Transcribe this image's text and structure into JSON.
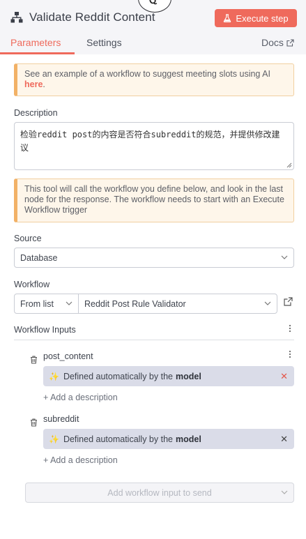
{
  "header": {
    "title": "Validate Reddit Content",
    "execute_label": "Execute step",
    "badge_text": "Q"
  },
  "tabs": {
    "parameters": "Parameters",
    "settings": "Settings",
    "docs": "Docs"
  },
  "notice_example": {
    "text": "See an example of a workflow to suggest meeting slots using AI ",
    "link": "here",
    "suffix": "."
  },
  "description": {
    "label": "Description",
    "value": "检验reddit post的内容是否符合subreddit的规范，并提供修改建议"
  },
  "notice_tool": {
    "text": "This tool will call the workflow you define below, and look in the last node for the response. The workflow needs to start with an Execute Workflow trigger"
  },
  "source": {
    "label": "Source",
    "value": "Database"
  },
  "workflow": {
    "label": "Workflow",
    "mode": "From list",
    "value": "Reddit Post Rule Validator"
  },
  "workflow_inputs": {
    "title": "Workflow Inputs",
    "items": [
      {
        "name": "post_content",
        "auto_text": "Defined automatically by the",
        "auto_bold": "model",
        "add_description": "+ Add a description"
      },
      {
        "name": "subreddit",
        "auto_text": "Defined automatically by the",
        "auto_bold": "model",
        "add_description": "+ Add a description"
      }
    ],
    "add_placeholder": "Add workflow input to send"
  },
  "colors": {
    "accent": "#ef6a5c",
    "notice_bg": "#fef6ea",
    "notice_border": "#f2b166",
    "auto_box_bg": "#dadce8"
  }
}
